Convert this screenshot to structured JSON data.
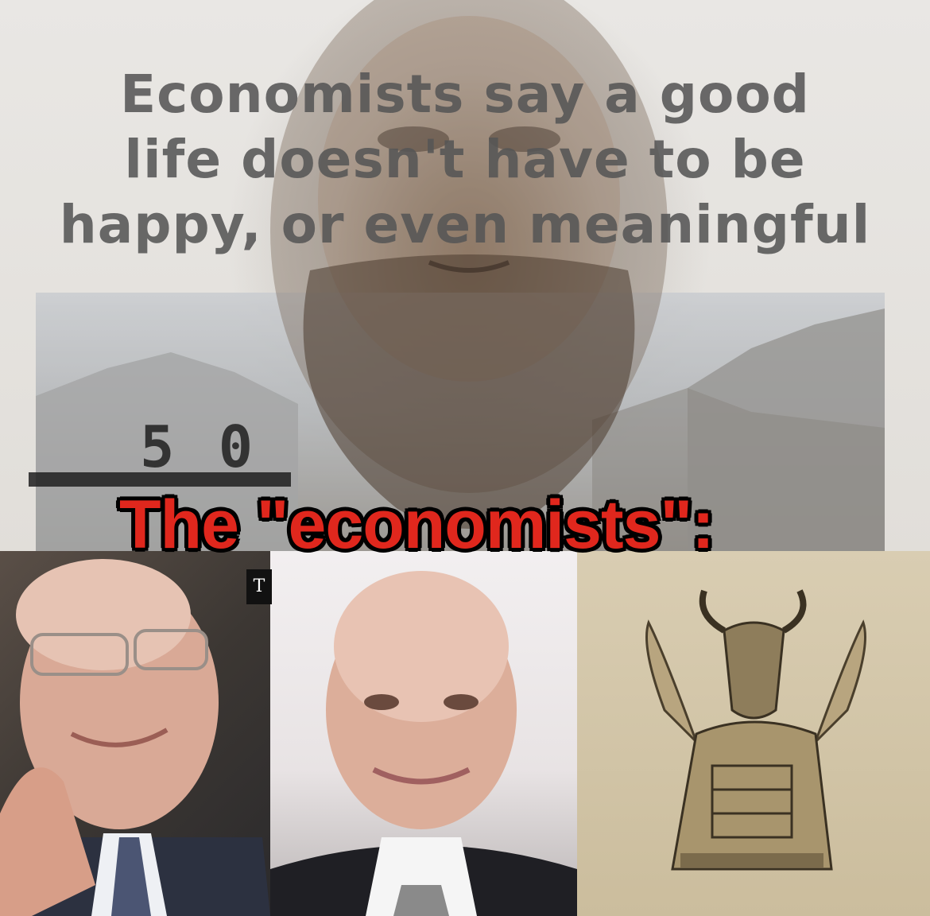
{
  "headline": {
    "line1": "Economists say a good",
    "line2": "life doesn't have to be",
    "line3": "happy, or even meaningful"
  },
  "mugshot_board_text": "5 0",
  "caption": "The \"economists\":",
  "panels": {
    "left": {
      "description_icon": "elderly-man-photo"
    },
    "middle": {
      "description_icon": "bald-man-photo"
    },
    "right": {
      "description_icon": "bull-headed-idol-engraving"
    }
  },
  "nyt_logo_letter": "T",
  "colors": {
    "caption_red": "#e0271d",
    "caption_outline": "#000000",
    "headline_gray": "#555555",
    "engraving_paper": "#d9cdb2"
  }
}
